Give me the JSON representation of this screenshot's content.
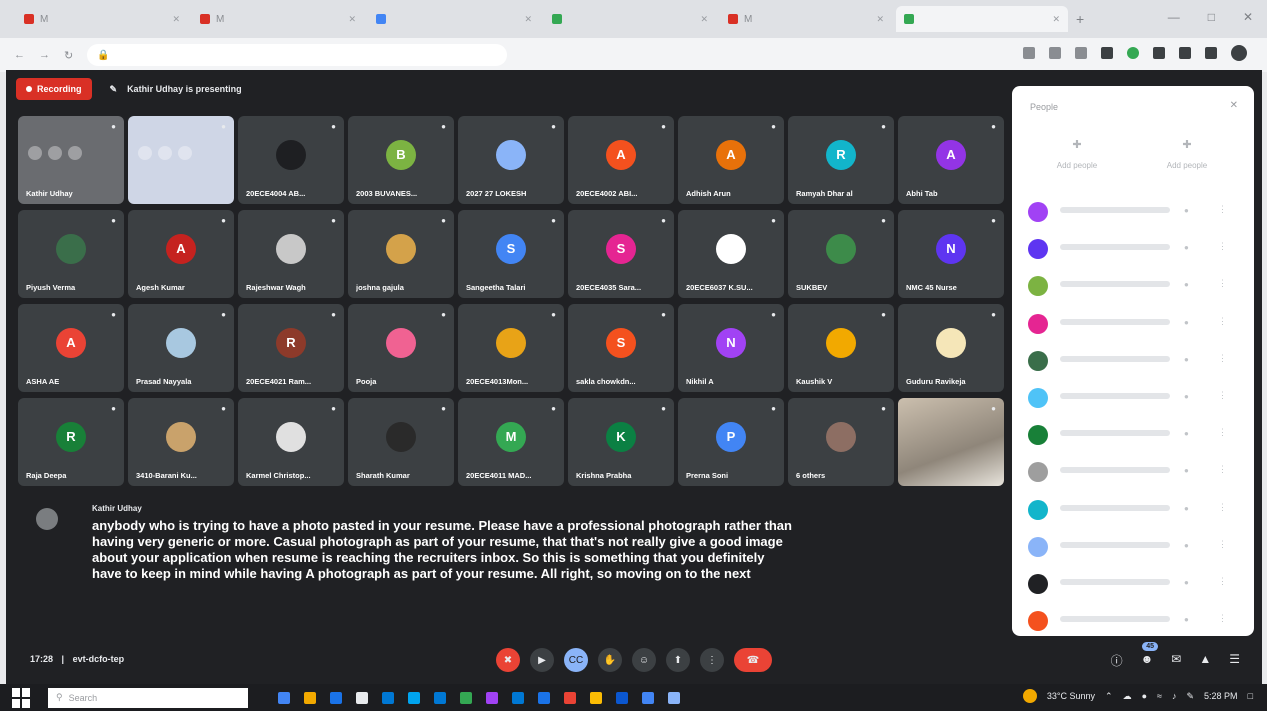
{
  "browser": {
    "tabs": [
      {
        "label": "M",
        "color": "#d93025",
        "active": false
      },
      {
        "label": "M",
        "color": "#d93025",
        "active": false
      },
      {
        "label": "",
        "color": "#4285f4",
        "active": false
      },
      {
        "label": "",
        "color": "#34a853",
        "active": false
      },
      {
        "label": "M",
        "color": "#d93025",
        "active": false
      },
      {
        "label": "",
        "color": "#34a853",
        "active": true
      }
    ],
    "new_tab_glyph": "+",
    "window_controls": [
      "—",
      "□",
      "✕"
    ]
  },
  "meet": {
    "recording_label": "Recording",
    "presenting_text": "Kathir Udhay is presenting",
    "tiles": [
      {
        "name": "Kathir Udhay",
        "type": "video",
        "variant": "dark",
        "initial": "",
        "color": "#6a6c70"
      },
      {
        "name": "",
        "type": "video",
        "variant": "light",
        "initial": "",
        "color": "#cfd6e6"
      },
      {
        "name": "20ECE4004 AB...",
        "type": "image",
        "initial": "",
        "color": "#1e1f22"
      },
      {
        "name": "2003 BUVANES...",
        "type": "avatar",
        "initial": "B",
        "color": "#7cb342"
      },
      {
        "name": "2027 27 LOKESH",
        "type": "image",
        "initial": "",
        "color": "#8ab4f8"
      },
      {
        "name": "20ECE4002 ABI...",
        "type": "avatar",
        "initial": "A",
        "color": "#f4511e"
      },
      {
        "name": "Adhish Arun",
        "type": "avatar",
        "initial": "A",
        "color": "#e8710a"
      },
      {
        "name": "Ramyah Dhar al",
        "type": "avatar",
        "initial": "R",
        "color": "#12b5cb"
      },
      {
        "name": "Abhi Tab",
        "type": "avatar",
        "initial": "A",
        "color": "#9334e6"
      },
      {
        "name": "Piyush Verma",
        "type": "image",
        "initial": "",
        "color": "#3a6e4a"
      },
      {
        "name": "Agesh Kumar",
        "type": "avatar",
        "initial": "A",
        "color": "#c5221f"
      },
      {
        "name": "Rajeshwar Wagh",
        "type": "image",
        "initial": "",
        "color": "#c8c8c8"
      },
      {
        "name": "joshna gajula",
        "type": "image",
        "initial": "",
        "color": "#d4a24a"
      },
      {
        "name": "Sangeetha Talari",
        "type": "avatar",
        "initial": "S",
        "color": "#4285f4"
      },
      {
        "name": "20ECE4035 Sara...",
        "type": "avatar",
        "initial": "S",
        "color": "#e52592"
      },
      {
        "name": "20ECE6037 K.SU...",
        "type": "image",
        "initial": "",
        "color": "#ffffff"
      },
      {
        "name": "SUKBEV",
        "type": "image",
        "initial": "",
        "color": "#3d8b4a"
      },
      {
        "name": "NMC 45 Nurse",
        "type": "avatar",
        "initial": "N",
        "color": "#5e35f1"
      },
      {
        "name": "ASHA AE",
        "type": "avatar",
        "initial": "A",
        "color": "#ea4335"
      },
      {
        "name": "Prasad Nayyala",
        "type": "image",
        "initial": "",
        "color": "#a8c8e0"
      },
      {
        "name": "20ECE4021 Ram...",
        "type": "avatar",
        "initial": "R",
        "color": "#8d3a2a"
      },
      {
        "name": "Pooja",
        "type": "image",
        "initial": "",
        "color": "#f06292"
      },
      {
        "name": "20ECE4013Mon...",
        "type": "image",
        "initial": "",
        "color": "#e8a317"
      },
      {
        "name": "sakla chowkdn...",
        "type": "avatar",
        "initial": "S",
        "color": "#f4511e"
      },
      {
        "name": "Nikhil A",
        "type": "avatar",
        "initial": "N",
        "color": "#a142f4"
      },
      {
        "name": "Kaushik V",
        "type": "image",
        "initial": "",
        "color": "#f2a900"
      },
      {
        "name": "Guduru Ravikeja",
        "type": "image",
        "initial": "",
        "color": "#f5e6b8"
      },
      {
        "name": "Raja Deepa",
        "type": "avatar",
        "initial": "R",
        "color": "#188038"
      },
      {
        "name": "3410-Barani Ku...",
        "type": "image",
        "initial": "",
        "color": "#c9a26b"
      },
      {
        "name": "Karmel Christop...",
        "type": "image",
        "initial": "",
        "color": "#e0e0e0"
      },
      {
        "name": "Sharath Kumar",
        "type": "image",
        "initial": "",
        "color": "#2a2a2a"
      },
      {
        "name": "20ECE4011 MAD...",
        "type": "avatar",
        "initial": "M",
        "color": "#34a853"
      },
      {
        "name": "Krishna Prabha",
        "type": "avatar",
        "initial": "K",
        "color": "#0b8043"
      },
      {
        "name": "Prerna Soni",
        "type": "avatar",
        "initial": "P",
        "color": "#4285f4"
      },
      {
        "name": "6 others",
        "type": "image",
        "initial": "",
        "color": "#8d6e63"
      },
      {
        "name": "",
        "type": "video",
        "variant": "person",
        "initial": "",
        "color": "#b9ad9c"
      }
    ],
    "caption": {
      "speaker": "Kathir Udhay",
      "text": "anybody who is trying to have a photo pasted in your resume. Please have a professional photograph rather than having very generic or more. Casual photograph as part of your resume, that that's not really give a good image about your application when resume is reaching the recruiters inbox. So this is something that you definitely have to keep in mind while having A photograph as part of your resume. All right, so moving on to the next"
    },
    "time": "17:28",
    "meeting_code": "evt-dcfo-tep",
    "controls": [
      {
        "name": "mic-off",
        "glyph": "✖",
        "style": "red"
      },
      {
        "name": "camera",
        "glyph": "▶",
        "style": "normal"
      },
      {
        "name": "captions",
        "glyph": "CC",
        "style": "blue"
      },
      {
        "name": "raise-hand",
        "glyph": "✋",
        "style": "normal"
      },
      {
        "name": "emoji",
        "glyph": "☺",
        "style": "normal"
      },
      {
        "name": "present",
        "glyph": "⬆",
        "style": "normal"
      },
      {
        "name": "more",
        "glyph": "⋮",
        "style": "normal"
      }
    ],
    "leave_glyph": "☎",
    "right_controls": [
      "ⓘ",
      "☻",
      "✉",
      "▲",
      "☰"
    ],
    "people_badge": "45"
  },
  "people_panel": {
    "title": "People",
    "actions": [
      "Add people",
      "Add people"
    ],
    "participant_colors": [
      "#a142f4",
      "#5e35f1",
      "#7cb342",
      "#e52592",
      "#3a6e4a",
      "#4fc3f7",
      "#188038",
      "#9e9e9e",
      "#12b5cb",
      "#8ab4f8",
      "#202124",
      "#f4511e"
    ]
  },
  "taskbar": {
    "search_placeholder": "Search",
    "app_colors": [
      "#4285f4",
      "#f2a900",
      "#1a73e8",
      "#e8eaed",
      "#0078d4",
      "#00a4ef",
      "#0078d4",
      "#34a853",
      "#a142f4",
      "#0078d4",
      "#1a73e8",
      "#ea4335",
      "#fbbc04",
      "#0b57d0",
      "#4285f4",
      "#8ab4f8"
    ],
    "weather": "33°C Sunny",
    "clock": "5:28 PM"
  }
}
